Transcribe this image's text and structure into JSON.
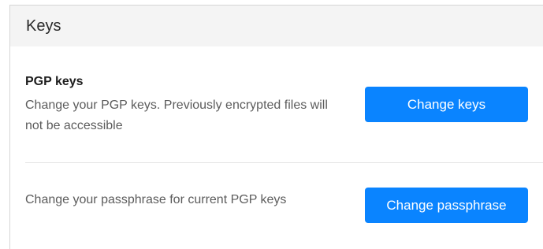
{
  "panel": {
    "title": "Keys"
  },
  "pgp": {
    "title": "PGP keys",
    "description": "Change your PGP keys. Previously encrypted files will not be accessible",
    "button_label": "Change keys"
  },
  "passphrase": {
    "description": "Change your passphrase for current PGP keys",
    "button_label": "Change passphrase"
  },
  "colors": {
    "accent": "#0a84ff",
    "header_bg": "#f4f4f4"
  }
}
